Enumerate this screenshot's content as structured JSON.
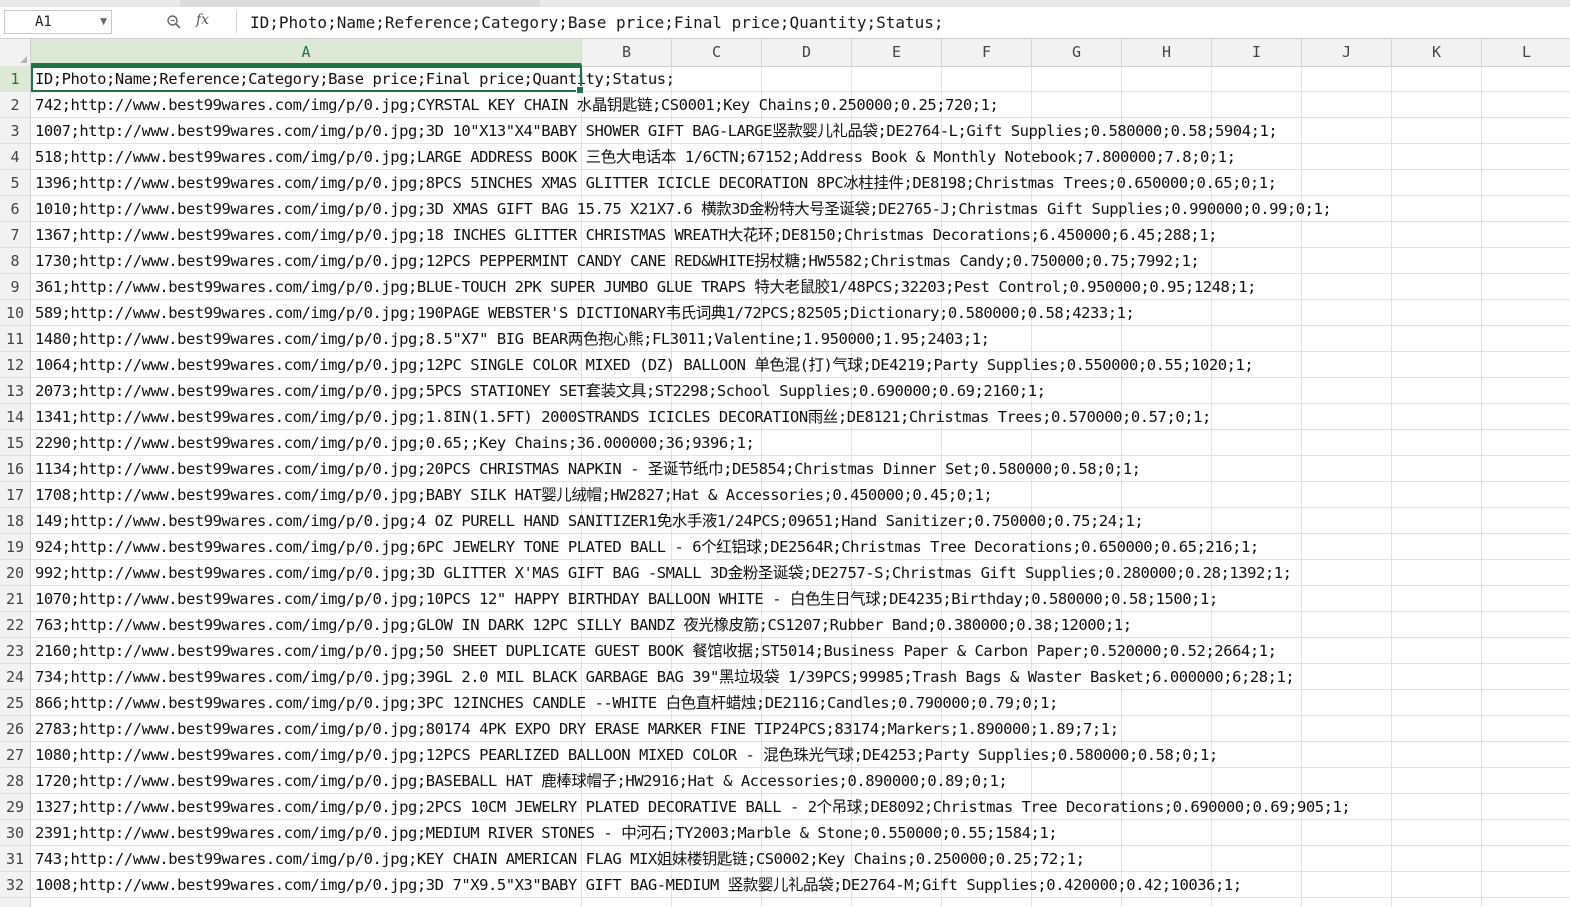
{
  "name_box": {
    "cell": "A1"
  },
  "formula_bar": {
    "fx_label": "fx",
    "content": "ID;Photo;Name;Reference;Category;Base price;Final price;Quantity;Status;"
  },
  "columns": [
    "A",
    "B",
    "C",
    "D",
    "E",
    "F",
    "G",
    "H",
    "I",
    "J",
    "K",
    "L"
  ],
  "selected": {
    "column": "A",
    "row": "1"
  },
  "rows": [
    {
      "num": "1",
      "text": "ID;Photo;Name;Reference;Category;Base price;Final price;Quantity;Status;"
    },
    {
      "num": "2",
      "text": "742;http://www.best99wares.com/img/p/0.jpg;CYRSTAL KEY CHAIN 水晶钥匙链;CS0001;Key Chains;0.250000;0.25;720;1;"
    },
    {
      "num": "3",
      "text": "1007;http://www.best99wares.com/img/p/0.jpg;3D 10\"X13\"X4\"BABY SHOWER GIFT BAG-LARGE竖款婴儿礼品袋;DE2764-L;Gift Supplies;0.580000;0.58;5904;1;"
    },
    {
      "num": "4",
      "text": "518;http://www.best99wares.com/img/p/0.jpg;LARGE ADDRESS BOOK 三色大电话本 1/6CTN;67152;Address Book & Monthly Notebook;7.800000;7.8;0;1;"
    },
    {
      "num": "5",
      "text": "1396;http://www.best99wares.com/img/p/0.jpg;8PCS 5INCHES XMAS GLITTER ICICLE DECORATION 8PC冰柱挂件;DE8198;Christmas Trees;0.650000;0.65;0;1;"
    },
    {
      "num": "6",
      "text": "1010;http://www.best99wares.com/img/p/0.jpg;3D XMAS GIFT BAG 15.75 X21X7.6 横款3D金粉特大号圣诞袋;DE2765-J;Christmas Gift Supplies;0.990000;0.99;0;1;"
    },
    {
      "num": "7",
      "text": "1367;http://www.best99wares.com/img/p/0.jpg;18 INCHES GLITTER CHRISTMAS WREATH大花环;DE8150;Christmas Decorations;6.450000;6.45;288;1;"
    },
    {
      "num": "8",
      "text": "1730;http://www.best99wares.com/img/p/0.jpg;12PCS PEPPERMINT CANDY CANE RED&WHITE拐杖糖;HW5582;Christmas Candy;0.750000;0.75;7992;1;"
    },
    {
      "num": "9",
      "text": "361;http://www.best99wares.com/img/p/0.jpg;BLUE-TOUCH 2PK SUPER JUMBO GLUE TRAPS 特大老鼠胶1/48PCS;32203;Pest Control;0.950000;0.95;1248;1;"
    },
    {
      "num": "10",
      "text": "589;http://www.best99wares.com/img/p/0.jpg;190PAGE WEBSTER'S DICTIONARY韦氏词典1/72PCS;82505;Dictionary;0.580000;0.58;4233;1;"
    },
    {
      "num": "11",
      "text": "1480;http://www.best99wares.com/img/p/0.jpg;8.5\"X7\" BIG BEAR两色抱心熊;FL3011;Valentine;1.950000;1.95;2403;1;"
    },
    {
      "num": "12",
      "text": "1064;http://www.best99wares.com/img/p/0.jpg;12PC SINGLE COLOR MIXED (DZ) BALLOON  单色混(打)气球;DE4219;Party Supplies;0.550000;0.55;1020;1;"
    },
    {
      "num": "13",
      "text": "2073;http://www.best99wares.com/img/p/0.jpg;5PCS STATIONEY SET套装文具;ST2298;School Supplies;0.690000;0.69;2160;1;"
    },
    {
      "num": "14",
      "text": "1341;http://www.best99wares.com/img/p/0.jpg;1.8IN(1.5FT) 2000STRANDS ICICLES DECORATION雨丝;DE8121;Christmas Trees;0.570000;0.57;0;1;"
    },
    {
      "num": "15",
      "text": "2290;http://www.best99wares.com/img/p/0.jpg;0.65;;Key Chains;36.000000;36;9396;1;"
    },
    {
      "num": "16",
      "text": "1134;http://www.best99wares.com/img/p/0.jpg;20PCS CHRISTMAS NAPKIN - 圣诞节纸巾;DE5854;Christmas Dinner Set;0.580000;0.58;0;1;"
    },
    {
      "num": "17",
      "text": "1708;http://www.best99wares.com/img/p/0.jpg;BABY SILK HAT婴儿绒帽;HW2827;Hat & Accessories;0.450000;0.45;0;1;"
    },
    {
      "num": "18",
      "text": "149;http://www.best99wares.com/img/p/0.jpg;4 OZ PURELL HAND SANITIZER1免水手液1/24PCS;09651;Hand Sanitizer;0.750000;0.75;24;1;"
    },
    {
      "num": "19",
      "text": "924;http://www.best99wares.com/img/p/0.jpg;6PC JEWELRY TONE PLATED BALL - 6个红铝球;DE2564R;Christmas Tree Decorations;0.650000;0.65;216;1;"
    },
    {
      "num": "20",
      "text": "992;http://www.best99wares.com/img/p/0.jpg;3D GLITTER  X'MAS GIFT BAG -SMALL 3D金粉圣诞袋;DE2757-S;Christmas Gift Supplies;0.280000;0.28;1392;1;"
    },
    {
      "num": "21",
      "text": "1070;http://www.best99wares.com/img/p/0.jpg;10PCS 12\" HAPPY BIRTHDAY BALLOON WHITE - 白色生日气球;DE4235;Birthday;0.580000;0.58;1500;1;"
    },
    {
      "num": "22",
      "text": "763;http://www.best99wares.com/img/p/0.jpg;GLOW IN DARK 12PC SILLY BANDZ 夜光橡皮筋;CS1207;Rubber Band;0.380000;0.38;12000;1;"
    },
    {
      "num": "23",
      "text": "2160;http://www.best99wares.com/img/p/0.jpg;50 SHEET  DUPLICATE  GUEST BOOK 餐馆收据;ST5014;Business Paper & Carbon Paper;0.520000;0.52;2664;1;"
    },
    {
      "num": "24",
      "text": "734;http://www.best99wares.com/img/p/0.jpg;39GL 2.0 MIL BLACK GARBAGE  BAG 39\"黑垃圾袋 1/39PCS;99985;Trash Bags & Waster Basket;6.000000;6;28;1;"
    },
    {
      "num": "25",
      "text": "866;http://www.best99wares.com/img/p/0.jpg;3PC  12INCHES CANDLE --WHITE  白色直杆蜡烛;DE2116;Candles;0.790000;0.79;0;1;"
    },
    {
      "num": "26",
      "text": "2783;http://www.best99wares.com/img/p/0.jpg;80174 4PK EXPO DRY ERASE MARKER FINE TIP24PCS;83174;Markers;1.890000;1.89;7;1;"
    },
    {
      "num": "27",
      "text": "1080;http://www.best99wares.com/img/p/0.jpg;12PCS PEARLIZED BALLOON MIXED COLOR - 混色珠光气球;DE4253;Party Supplies;0.580000;0.58;0;1;"
    },
    {
      "num": "28",
      "text": "1720;http://www.best99wares.com/img/p/0.jpg;BASEBALL HAT 鹿棒球帽子;HW2916;Hat & Accessories;0.890000;0.89;0;1;"
    },
    {
      "num": "29",
      "text": "1327;http://www.best99wares.com/img/p/0.jpg;2PCS 10CM JEWELRY PLATED DECORATIVE BALL - 2个吊球;DE8092;Christmas Tree Decorations;0.690000;0.69;905;1;"
    },
    {
      "num": "30",
      "text": "2391;http://www.best99wares.com/img/p/0.jpg;MEDIUM RIVER STONES - 中河石;TY2003;Marble & Stone;0.550000;0.55;1584;1;"
    },
    {
      "num": "31",
      "text": "743;http://www.best99wares.com/img/p/0.jpg;KEY CHAIN AMERICAN FLAG  MIX姐妹楼钥匙链;CS0002;Key Chains;0.250000;0.25;72;1;"
    },
    {
      "num": "32",
      "text": "1008;http://www.best99wares.com/img/p/0.jpg;3D 7\"X9.5\"X3\"BABY GIFT BAG-MEDIUM 竖款婴儿礼品袋;DE2764-M;Gift Supplies;0.420000;0.42;10036;1;"
    }
  ]
}
